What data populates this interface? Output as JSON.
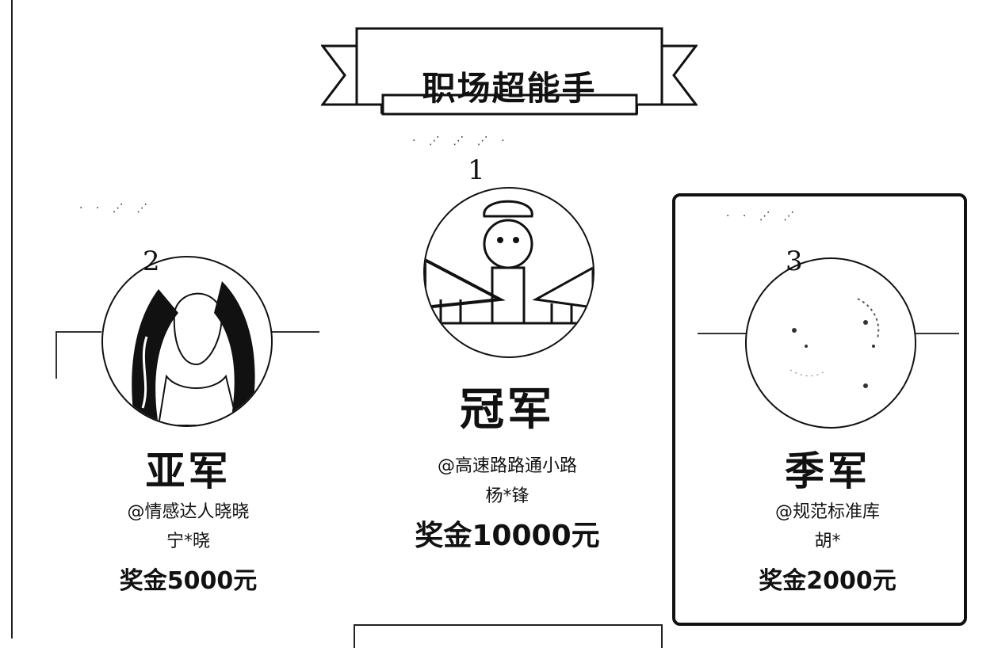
{
  "banner": {
    "title": "职场超能手"
  },
  "podium": {
    "first": {
      "rank": "1",
      "title": "冠军",
      "handle": "@高速路路通小路",
      "winner": "杨*锋",
      "prize": "奖金10000元",
      "avatar": "avatar-cartoon-chef"
    },
    "second": {
      "rank": "2",
      "title": "亚军",
      "handle": "@情感达人晓晓",
      "winner": "宁*晓",
      "prize": "奖金5000元",
      "avatar": "avatar-woman-curly-hair"
    },
    "third": {
      "rank": "3",
      "title": "季军",
      "handle": "@规范标准库",
      "winner": "胡*",
      "prize": "奖金2000元",
      "avatar": "avatar-faint-portrait"
    }
  },
  "colors": {
    "ink": "#111111",
    "background": "#ffffff"
  }
}
